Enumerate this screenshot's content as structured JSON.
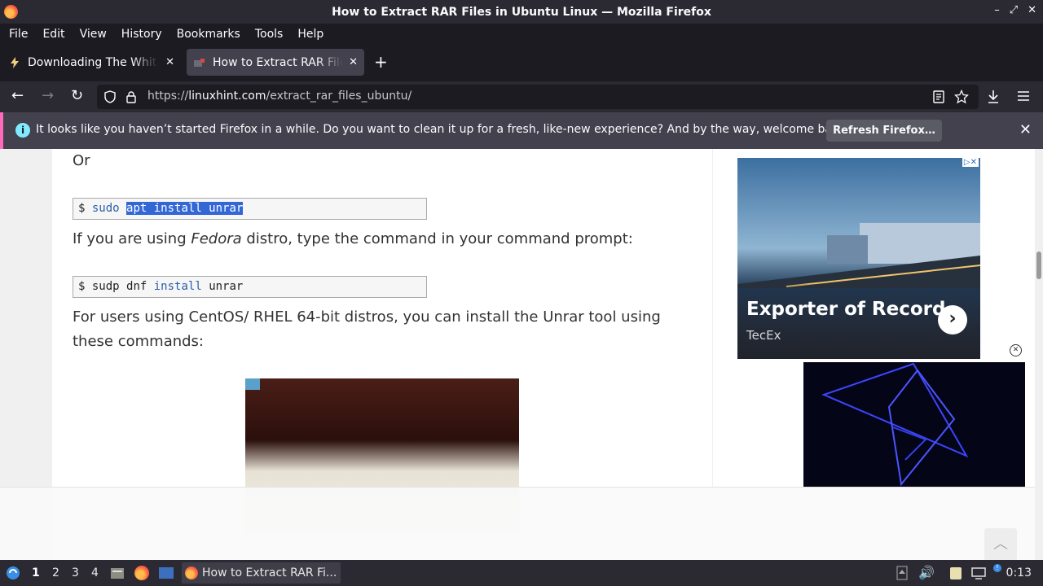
{
  "window": {
    "title": "How to Extract RAR Files in Ubuntu Linux — Mozilla Firefox",
    "controls": [
      "–",
      "⤢",
      "✕"
    ]
  },
  "menu": [
    "File",
    "Edit",
    "View",
    "History",
    "Bookmarks",
    "Tools",
    "Help"
  ],
  "tabs": [
    {
      "label": "Downloading The White I",
      "active": false
    },
    {
      "label": "How to Extract RAR Files",
      "active": true
    }
  ],
  "urlbar": {
    "prefix": "https://",
    "domain": "linuxhint.com",
    "path": "/extract_rar_files_ubuntu/"
  },
  "notification": {
    "message": "It looks like you haven’t started Firefox in a while. Do you want to clean it up for a fresh, like-new experience? And by the way, welcome back!",
    "button": "Refresh Firefox…"
  },
  "article": {
    "or": "Or",
    "code1": {
      "prompt": "$",
      "cmd": "sudo",
      "selected": "apt install unrar"
    },
    "fedora_pre": "If you are using ",
    "fedora_em": "Fedora",
    "fedora_post": " distro, type the command in your command prompt:",
    "code2": {
      "prompt": "$",
      "cmd": "sudp dnf",
      "kw": "install",
      "arg": "unrar"
    },
    "centos_line1": "For users using CentOS/ RHEL 64-bit distros, you can install the Unrar tool using",
    "centos_line2": "these commands:"
  },
  "ad": {
    "title": "Exporter of Record",
    "sponsor": "TecEx",
    "adchoices": "▷✕"
  },
  "taskbar": {
    "workspaces": [
      "1",
      "2",
      "3",
      "4"
    ],
    "active_window": "How to Extract RAR Fi...",
    "clock": "0:13"
  }
}
